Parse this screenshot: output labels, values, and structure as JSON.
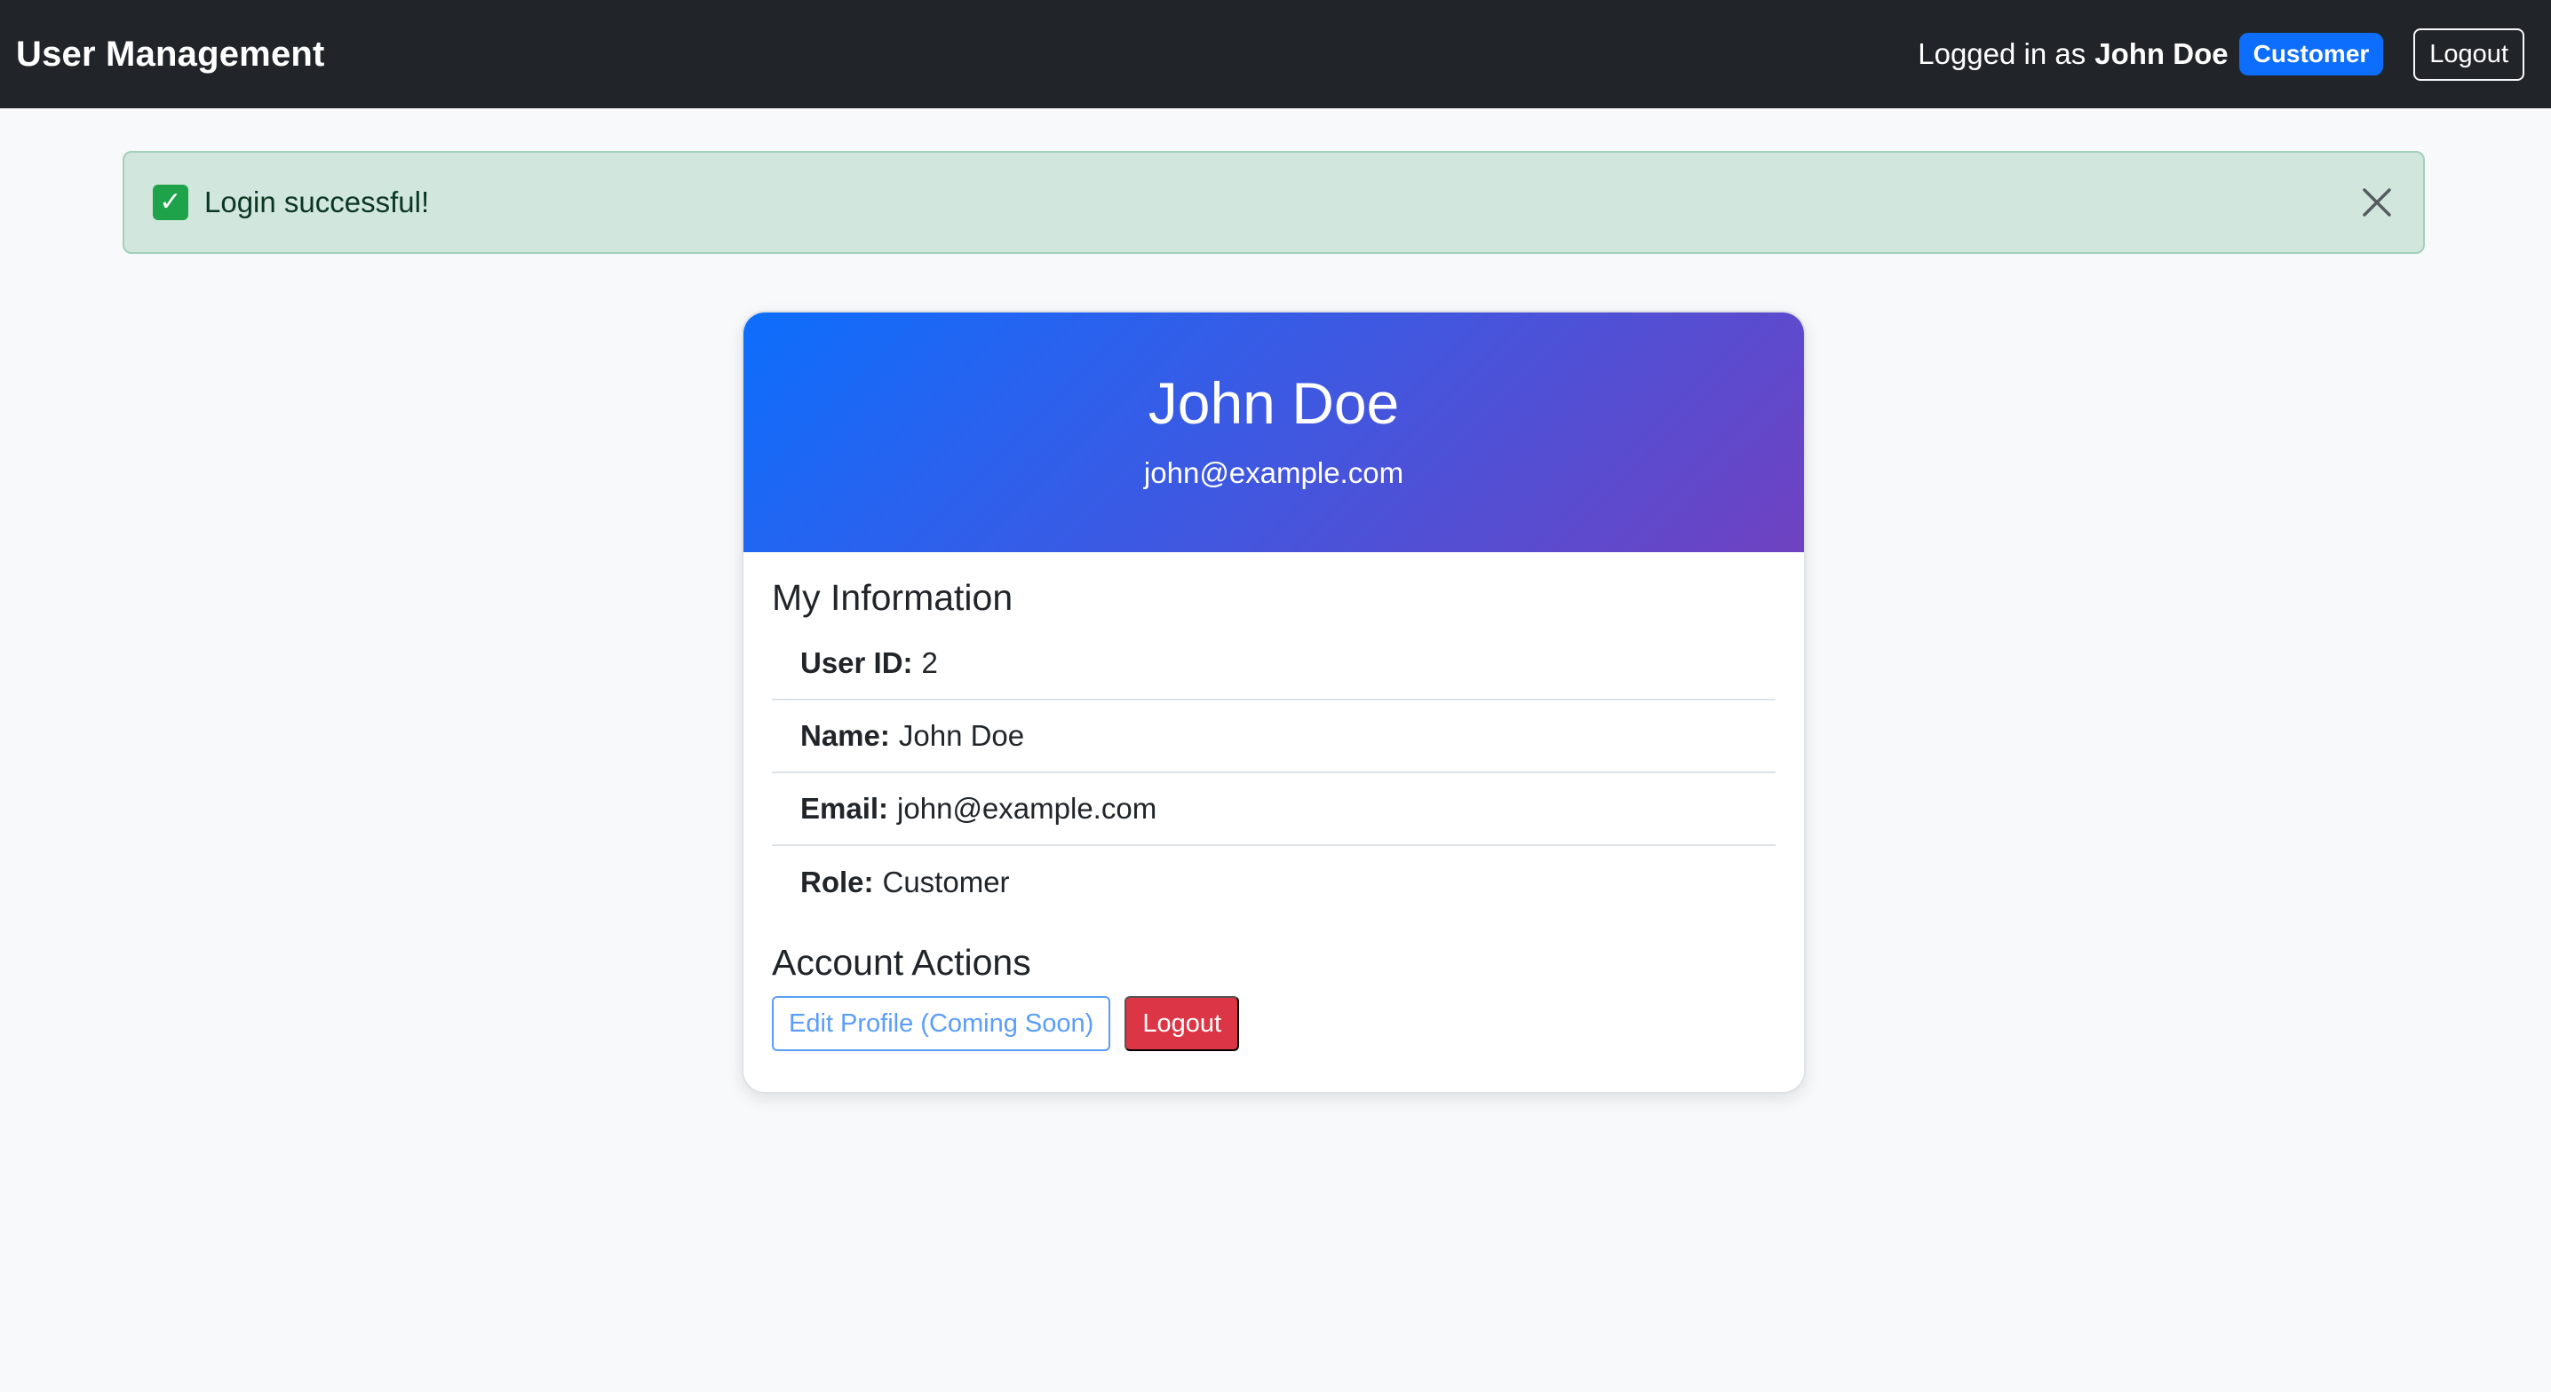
{
  "navbar": {
    "brand": "User Management",
    "logged_in_prefix": "Logged in as",
    "user_name": "John Doe",
    "role_badge": "Customer",
    "logout_label": "Logout"
  },
  "alert": {
    "icon": "check-mark-icon",
    "message": "Login successful!",
    "close_icon": "close-icon",
    "colors": {
      "background": "#d1e7dd",
      "border": "#a3cfbb",
      "icon": "#1fa34a"
    }
  },
  "profile": {
    "name": "John Doe",
    "email": "john@example.com",
    "header_gradient": [
      "#0d6efd",
      "#6f42c1"
    ]
  },
  "info": {
    "title": "My Information",
    "items": [
      {
        "label": "User ID:",
        "value": "2"
      },
      {
        "label": "Name:",
        "value": "John Doe"
      },
      {
        "label": "Email:",
        "value": "john@example.com"
      },
      {
        "label": "Role:",
        "value": "Customer"
      }
    ]
  },
  "actions": {
    "title": "Account Actions",
    "edit_label": "Edit Profile (Coming Soon)",
    "logout_label": "Logout",
    "colors": {
      "edit": "#5a9dfa",
      "logout": "#dc3545"
    }
  }
}
